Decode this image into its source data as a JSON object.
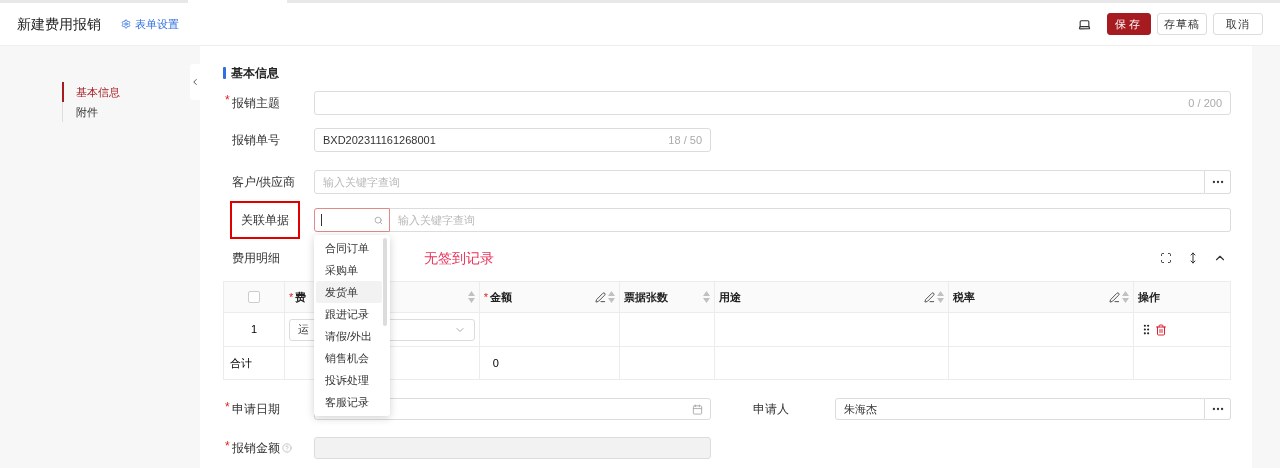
{
  "header": {
    "title": "新建费用报销",
    "settings_link": "表单设置",
    "buttons": [
      {
        "label": "保存",
        "kind": "primary"
      },
      {
        "label": "存草稿",
        "kind": "default"
      },
      {
        "label": "取消",
        "kind": "default"
      }
    ]
  },
  "sidebar": {
    "items": [
      {
        "label": "基本信息",
        "selected": true
      },
      {
        "label": "附件",
        "selected": false
      }
    ]
  },
  "section_title": "基本信息",
  "fields": [
    {
      "label": "报销主题",
      "required_mark": "*",
      "highlighted": false,
      "kind": "text",
      "counter": "0 / 200"
    },
    {
      "label": "报销单号",
      "highlighted": false,
      "kind": "short-text",
      "value": "BXD202311161268001",
      "counter": "18 / 50"
    },
    {
      "label": "客户/供应商",
      "highlighted": false,
      "kind": "picker",
      "placeholder": "输入关键字查询"
    },
    {
      "label": "关联单据",
      "highlighted": true,
      "kind": "linked",
      "placeholder": "输入关键字查询"
    }
  ],
  "details": {
    "title": "费用明细",
    "note": "无签到记录",
    "columns": [
      {
        "label": "费",
        "required_mark": "*",
        "sortable": true
      },
      {
        "label": "金额",
        "required_mark": "*",
        "editable": true,
        "sortable": true
      },
      {
        "label": "票据张数",
        "sortable": true
      },
      {
        "label": "用途",
        "editable": true,
        "sortable": true
      },
      {
        "label": "税率",
        "editable": true,
        "sortable": true
      },
      {
        "label": "操作"
      }
    ],
    "header_checked": false,
    "rows": [
      {
        "index": "1",
        "type": "运"
      }
    ],
    "total": {
      "label": "合计",
      "amount": "0"
    }
  },
  "bottom": {
    "date": {
      "label": "申请日期",
      "required_mark": "*"
    },
    "applicant": {
      "label": "申请人",
      "value": "朱海杰"
    },
    "amount": {
      "label": "报销金额",
      "required_mark": "*",
      "help": true
    }
  },
  "dropdown": {
    "items": [
      {
        "label": "合同订单",
        "selected": false
      },
      {
        "label": "采购单",
        "selected": false
      },
      {
        "label": "发货单",
        "selected": true
      },
      {
        "label": "跟进记录",
        "selected": false
      },
      {
        "label": "请假/外出",
        "selected": false
      },
      {
        "label": "销售机会",
        "selected": false
      },
      {
        "label": "投诉处理",
        "selected": false
      },
      {
        "label": "客服记录",
        "selected": false
      }
    ]
  }
}
